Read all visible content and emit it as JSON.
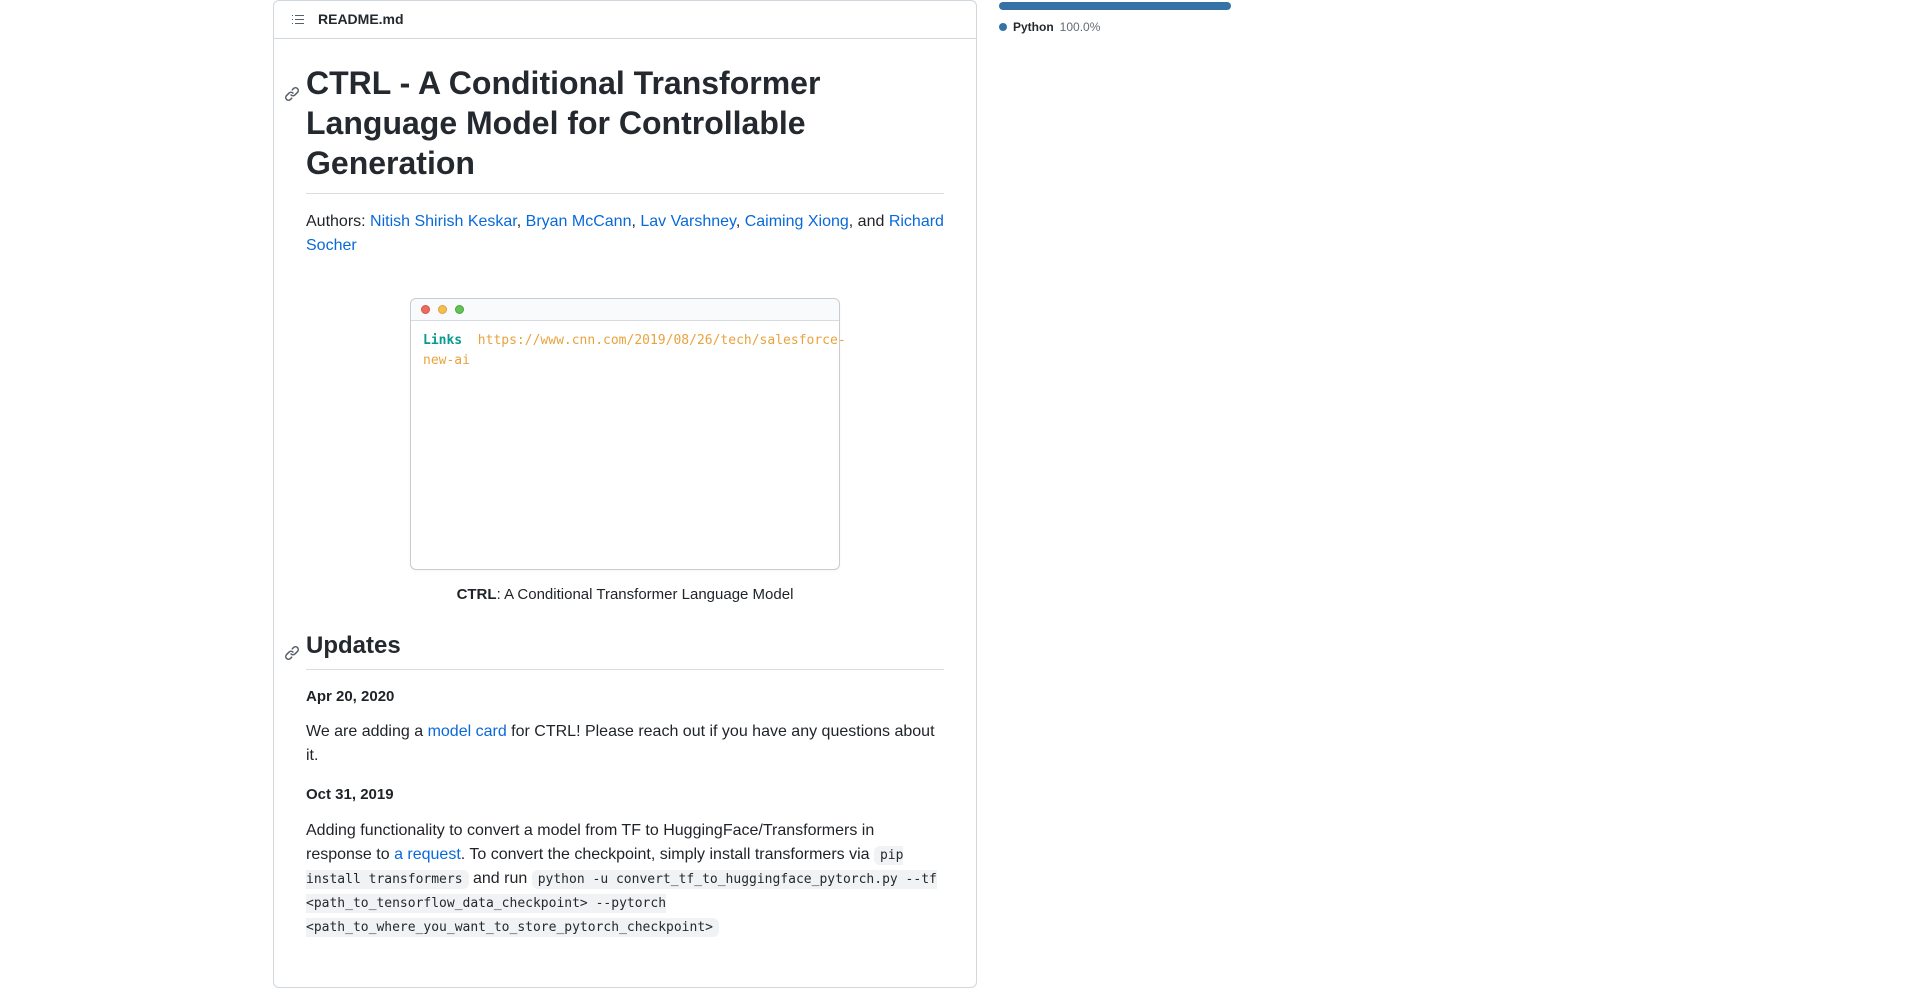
{
  "readme": {
    "filename": "README.md",
    "title": "CTRL - A Conditional Transformer Language Model for Controllable Generation",
    "authors_prefix": "Authors: ",
    "authors": [
      {
        "name": "Nitish Shirish Keskar"
      },
      {
        "name": "Bryan McCann"
      },
      {
        "name": "Lav Varshney"
      },
      {
        "name": "Caiming Xiong"
      },
      {
        "name": "Richard Socher"
      }
    ],
    "authors_sep": ", ",
    "authors_last_sep": ", and ",
    "terminal": {
      "prompt": "Links",
      "url": "https://www.cnn.com/2019/08/26/tech/salesforce-new-ai"
    },
    "caption_bold": "CTRL",
    "caption_rest": ": A Conditional Transformer Language Model",
    "updates_heading": "Updates",
    "update1": {
      "date": "Apr 20, 2020",
      "pre": "We are adding a ",
      "link": "model card",
      "post": " for CTRL! Please reach out if you have any questions about it."
    },
    "update2": {
      "date": "Oct 31, 2019",
      "pre": "Adding functionality to convert a model from TF to HuggingFace/Transformers in response to ",
      "link": "a request",
      "mid1": ". To convert the checkpoint, simply install transformers via ",
      "code1": "pip install transformers",
      "mid2": " and run ",
      "code2": "python -u convert_tf_to_huggingface_pytorch.py --tf <path_to_tensorflow_data_checkpoint> --pytorch <path_to_where_you_want_to_store_pytorch_checkpoint>"
    }
  },
  "languages": {
    "name": "Python",
    "pct": "100.0%",
    "color": "#3572a5"
  }
}
